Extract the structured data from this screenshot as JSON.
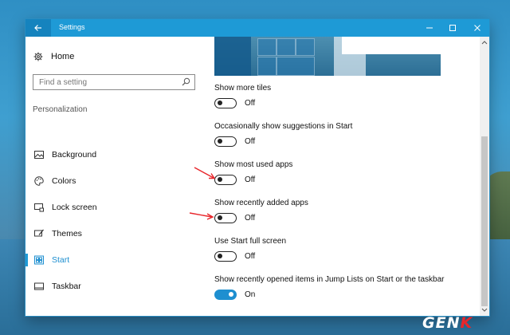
{
  "window": {
    "title": "Settings",
    "back_icon": "arrow-left-icon",
    "controls": [
      "minimize-icon",
      "maximize-icon",
      "close-icon"
    ]
  },
  "sidebar": {
    "home_label": "Home",
    "search_placeholder": "Find a setting",
    "section": "Personalization",
    "items": [
      {
        "label": "Background",
        "icon": "picture-icon",
        "active": false
      },
      {
        "label": "Colors",
        "icon": "palette-icon",
        "active": false
      },
      {
        "label": "Lock screen",
        "icon": "monitor-lock-icon",
        "active": false
      },
      {
        "label": "Themes",
        "icon": "brush-icon",
        "active": false
      },
      {
        "label": "Start",
        "icon": "start-tiles-icon",
        "active": true
      },
      {
        "label": "Taskbar",
        "icon": "taskbar-icon",
        "active": false
      }
    ]
  },
  "content": {
    "settings": [
      {
        "label": "Show more tiles",
        "state": "Off",
        "on": false
      },
      {
        "label": "Occasionally show suggestions in Start",
        "state": "Off",
        "on": false
      },
      {
        "label": "Show most used apps",
        "state": "Off",
        "on": false
      },
      {
        "label": "Show recently added apps",
        "state": "Off",
        "on": false
      },
      {
        "label": "Use Start full screen",
        "state": "Off",
        "on": false
      },
      {
        "label": "Show recently opened items in Jump Lists on Start or the taskbar",
        "state": "On",
        "on": true
      }
    ]
  },
  "colors": {
    "accent": "#1e9ad6",
    "annotation_arrow": "#e8262b"
  },
  "watermark": {
    "main": "GEN",
    "accent": "K"
  }
}
